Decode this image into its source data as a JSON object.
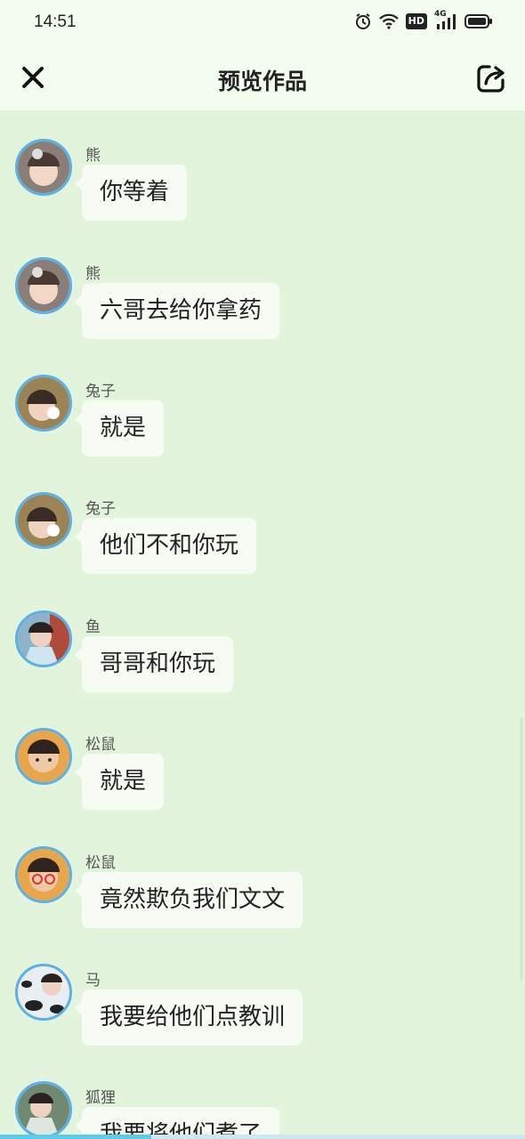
{
  "status_bar": {
    "time": "14:51",
    "network": "4G",
    "hd": "HD"
  },
  "header": {
    "title": "预览作品",
    "close_icon": "close-icon",
    "share_icon": "share-icon"
  },
  "messages": [
    {
      "name": "熊",
      "text": "你等着",
      "avatar_color": "#8a7f78"
    },
    {
      "name": "熊",
      "text": "六哥去给你拿药",
      "avatar_color": "#8a7f78"
    },
    {
      "name": "兔子",
      "text": "就是",
      "avatar_color": "#9a8456"
    },
    {
      "name": "兔子",
      "text": "他们不和你玩",
      "avatar_color": "#9a8456"
    },
    {
      "name": "鱼",
      "text": "哥哥和你玩",
      "avatar_color": "#8db3c8"
    },
    {
      "name": "松鼠",
      "text": "就是",
      "avatar_color": "#e7a64b"
    },
    {
      "name": "松鼠",
      "text": "竟然欺负我们文文",
      "avatar_color": "#e7a64b"
    },
    {
      "name": "马",
      "text": "我要给他们点教训",
      "avatar_color": "#9fb2c0"
    },
    {
      "name": "狐狸",
      "text": "我要将他们煮了",
      "avatar_color": "#6f8a70"
    }
  ],
  "colors": {
    "background": "#e3f4dc",
    "header": "#f4fcf0",
    "bubble": "#f6fcf3",
    "avatar_ring": "#5bb1e6"
  }
}
